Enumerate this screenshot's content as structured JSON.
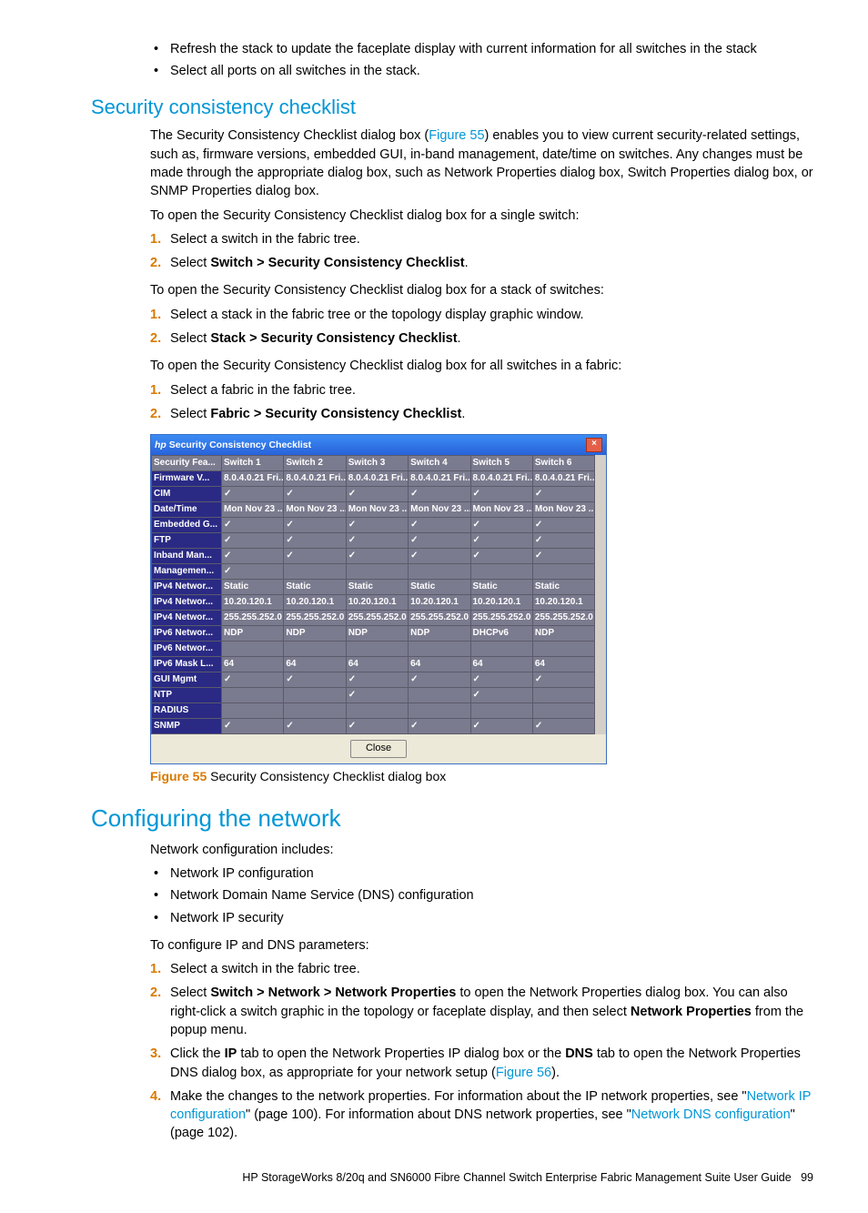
{
  "intro_bullets": [
    "Refresh the stack to update the faceplate display with current information for all switches in the stack",
    "Select all ports on all switches in the stack."
  ],
  "sec1": {
    "heading": "Security consistency checklist",
    "para1a": "The Security Consistency Checklist dialog box (",
    "fig_ref": "Figure 55",
    "para1b": ") enables you to view current security-related settings, such as, firmware versions, embedded GUI, in-band management, date/time on switches. Any changes must be made through the appropriate dialog box, such as Network Properties dialog box, Switch Properties dialog box, or SNMP Properties dialog box.",
    "p2": "To open the Security Consistency Checklist dialog box for a single switch:",
    "steps1": [
      {
        "pre": "Select a switch in the fabric tree.",
        "bold": "",
        "post": ""
      },
      {
        "pre": "Select ",
        "bold": "Switch > Security Consistency Checklist",
        "post": "."
      }
    ],
    "p3": "To open the Security Consistency Checklist dialog box for a stack of switches:",
    "steps2": [
      {
        "pre": "Select a stack in the fabric tree or the topology display graphic window.",
        "bold": "",
        "post": ""
      },
      {
        "pre": "Select ",
        "bold": "Stack > Security Consistency Checklist",
        "post": "."
      }
    ],
    "p4": "To open the Security Consistency Checklist dialog box for all switches in a fabric:",
    "steps3": [
      {
        "pre": "Select a fabric in the fabric tree.",
        "bold": "",
        "post": ""
      },
      {
        "pre": "Select ",
        "bold": "Fabric > Security Consistency Checklist",
        "post": "."
      }
    ]
  },
  "dialog": {
    "title": "Security Consistency Checklist",
    "close_btn": "Close",
    "headers": [
      "Security Fea...",
      "Switch 1",
      "Switch 2",
      "Switch 3",
      "Switch 4",
      "Switch 5",
      "Switch 6"
    ],
    "rows": [
      {
        "h": "Firmware V...",
        "c": [
          "8.0.4.0.21 Fri...",
          "8.0.4.0.21 Fri...",
          "8.0.4.0.21 Fri...",
          "8.0.4.0.21 Fri...",
          "8.0.4.0.21 Fri...",
          "8.0.4.0.21 Fri..."
        ]
      },
      {
        "h": "CIM",
        "c": [
          "✓",
          "✓",
          "✓",
          "✓",
          "✓",
          "✓"
        ]
      },
      {
        "h": "Date/Time",
        "c": [
          "Mon Nov 23 ...",
          "Mon Nov 23 ...",
          "Mon Nov 23 ...",
          "Mon Nov 23 ...",
          "Mon Nov 23 ...",
          "Mon Nov 23 ..."
        ]
      },
      {
        "h": "Embedded G...",
        "c": [
          "✓",
          "✓",
          "✓",
          "✓",
          "✓",
          "✓"
        ]
      },
      {
        "h": "FTP",
        "c": [
          "✓",
          "✓",
          "✓",
          "✓",
          "✓",
          "✓"
        ]
      },
      {
        "h": "Inband Man...",
        "c": [
          "✓",
          "✓",
          "✓",
          "✓",
          "✓",
          "✓"
        ]
      },
      {
        "h": "Managemen...",
        "c": [
          "✓",
          "",
          "",
          "",
          "",
          ""
        ]
      },
      {
        "h": "IPv4 Networ...",
        "c": [
          "Static",
          "Static",
          "Static",
          "Static",
          "Static",
          "Static"
        ]
      },
      {
        "h": "IPv4 Networ...",
        "c": [
          "10.20.120.1",
          "10.20.120.1",
          "10.20.120.1",
          "10.20.120.1",
          "10.20.120.1",
          "10.20.120.1"
        ]
      },
      {
        "h": "IPv4 Networ...",
        "c": [
          "255.255.252.0",
          "255.255.252.0",
          "255.255.252.0",
          "255.255.252.0",
          "255.255.252.0",
          "255.255.252.0"
        ]
      },
      {
        "h": "IPv6 Networ...",
        "c": [
          "NDP",
          "NDP",
          "NDP",
          "NDP",
          "DHCPv6",
          "NDP"
        ]
      },
      {
        "h": "IPv6 Networ...",
        "c": [
          "",
          "",
          "",
          "",
          "",
          ""
        ]
      },
      {
        "h": "IPv6 Mask L...",
        "c": [
          "64",
          "64",
          "64",
          "64",
          "64",
          "64"
        ]
      },
      {
        "h": "GUI Mgmt",
        "c": [
          "✓",
          "✓",
          "✓",
          "✓",
          "✓",
          "✓"
        ]
      },
      {
        "h": "NTP",
        "c": [
          "",
          "",
          "✓",
          "",
          "✓",
          ""
        ]
      },
      {
        "h": "RADIUS",
        "c": [
          "",
          "",
          "",
          "",
          "",
          ""
        ]
      },
      {
        "h": "SNMP",
        "c": [
          "✓",
          "✓",
          "✓",
          "✓",
          "✓",
          "✓"
        ]
      }
    ]
  },
  "fig": {
    "num": "Figure 55",
    "cap": " Security Consistency Checklist dialog box"
  },
  "sec2": {
    "heading": "Configuring the network",
    "p1": "Network configuration includes:",
    "bullets": [
      "Network IP configuration",
      "Network Domain Name Service (DNS) configuration",
      "Network IP security"
    ],
    "p2": "To configure IP and DNS parameters:",
    "steps": [
      {
        "n": "1.",
        "pre": "Select a switch in the fabric tree."
      },
      {
        "n": "2.",
        "pre": "Select ",
        "b1": "Switch > Network > Network Properties",
        "mid": " to open the Network Properties dialog box. You can also right-click a switch graphic in the topology or faceplate display, and then select ",
        "b2": "Network Properties",
        "post": " from the popup menu."
      },
      {
        "n": "3.",
        "pre": "Click the ",
        "b1": "IP",
        "mid": " tab to open the Network Properties IP dialog box or the ",
        "b2": "DNS",
        "post": " tab to open the Network Properties DNS dialog box, as appropriate for your network setup (",
        "link": "Figure 56",
        "tail": ")."
      },
      {
        "n": "4.",
        "pre": "Make the changes to the network properties. For information about the IP network properties, see \"",
        "link1": "Network IP configuration",
        "mid": "\" (page 100). For information about DNS network properties, see \"",
        "link2": "Network DNS configuration",
        "post": "\" (page 102)."
      }
    ]
  },
  "footer": {
    "text": "HP StorageWorks 8/20q and SN6000 Fibre Channel Switch Enterprise Fabric Management Suite User Guide",
    "page": "99"
  }
}
